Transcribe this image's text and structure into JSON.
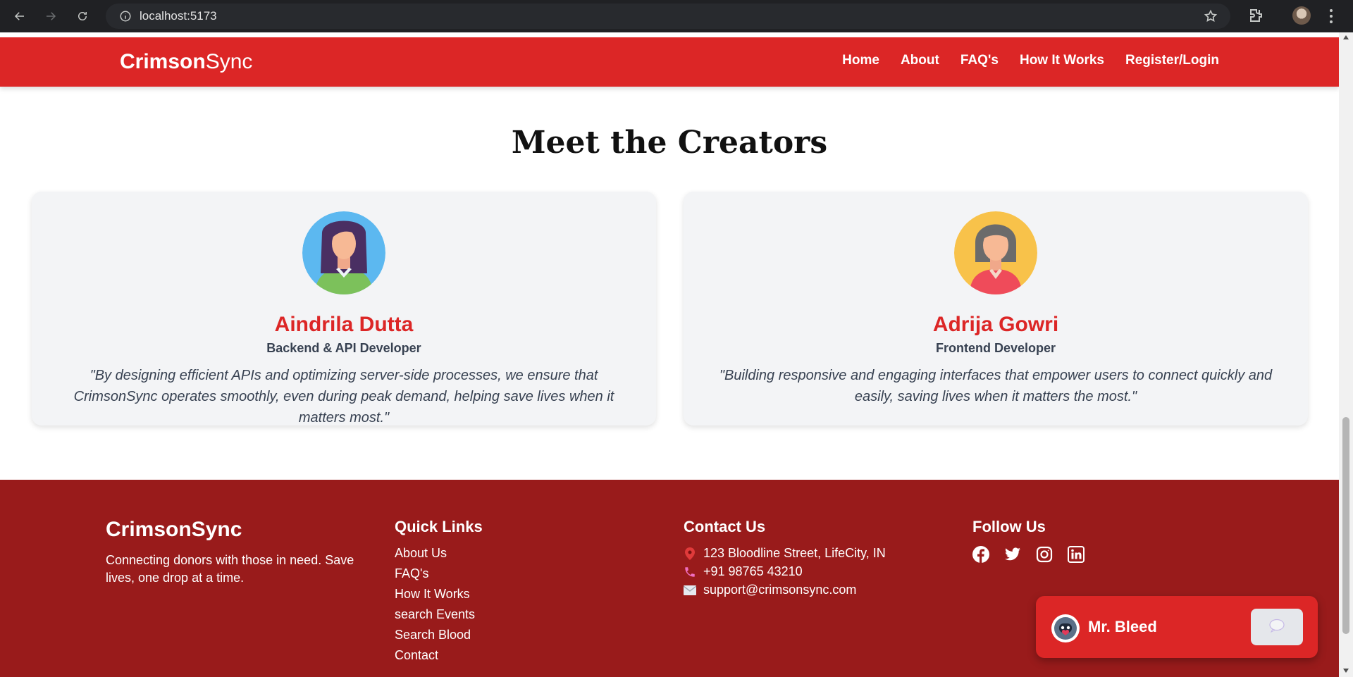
{
  "browser": {
    "url": "localhost:5173"
  },
  "nav": {
    "brand_bold": "Crimson",
    "brand_light": "Sync",
    "links": [
      "Home",
      "About",
      "FAQ's",
      "How It Works",
      "Register/Login"
    ]
  },
  "section": {
    "title": "Meet the Creators"
  },
  "creators": [
    {
      "name": "Aindrila Dutta",
      "role": "Backend & API Developer",
      "quote": "\"By designing efficient APIs and optimizing server-side processes, we ensure that CrimsonSync operates smoothly, even during peak demand, helping save lives when it matters most.\""
    },
    {
      "name": "Adrija Gowri",
      "role": "Frontend Developer",
      "quote": "\"Building responsive and engaging interfaces that empower users to connect quickly and easily, saving lives when it matters the most.\""
    }
  ],
  "footer": {
    "brand": "CrimsonSync",
    "tagline": "Connecting donors with those in need. Save lives, one drop at a time.",
    "quick_links_title": "Quick Links",
    "quick_links": [
      "About Us",
      "FAQ's",
      "How It Works",
      "search Events",
      "Search Blood",
      "Contact"
    ],
    "contact_title": "Contact Us",
    "contact": {
      "address": "123 Bloodline Street, LifeCity, IN",
      "phone": "+91 98765 43210",
      "email": "support@crimsonsync.com"
    },
    "follow_title": "Follow Us",
    "socials": [
      "facebook-icon",
      "twitter-icon",
      "instagram-icon",
      "linkedin-icon"
    ]
  },
  "chat": {
    "title": "Mr. Bleed"
  },
  "colors": {
    "nav_red": "#dc2626",
    "footer_red": "#991b1b",
    "text_dark": "#374151"
  }
}
